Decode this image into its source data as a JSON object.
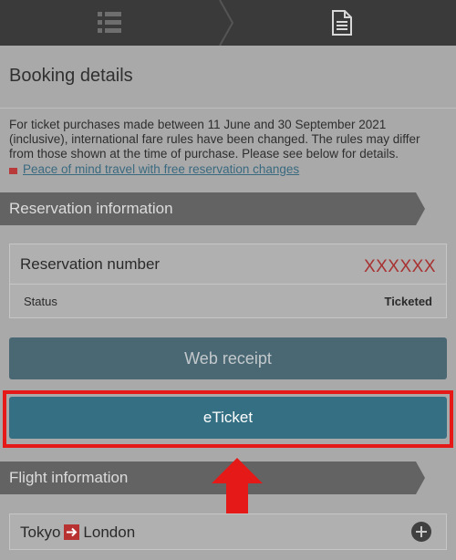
{
  "topnav": {
    "tabs": [
      {
        "icon": "list-icon",
        "active": false
      },
      {
        "icon": "document-icon",
        "active": true
      }
    ]
  },
  "page": {
    "title": "Booking details",
    "notice": "For ticket purchases made between 11 June and 30 September 2021 (inclusive), international fare rules have been changed. The rules may differ from those shown at the time of purchase. Please see below for details.",
    "notice_link": "Peace of mind travel with free reservation changes"
  },
  "reservation": {
    "section_title": "Reservation information",
    "number_label": "Reservation number",
    "number_value": "XXXXXX",
    "status_label": "Status",
    "status_value": "Ticketed"
  },
  "buttons": {
    "web_receipt": "Web receipt",
    "eticket": "eTicket"
  },
  "flight": {
    "section_title": "Flight information",
    "origin": "Tokyo",
    "destination": "London"
  },
  "colors": {
    "accent_red": "#e61919",
    "button_teal": "#356f84",
    "value_red": "#a83232"
  }
}
